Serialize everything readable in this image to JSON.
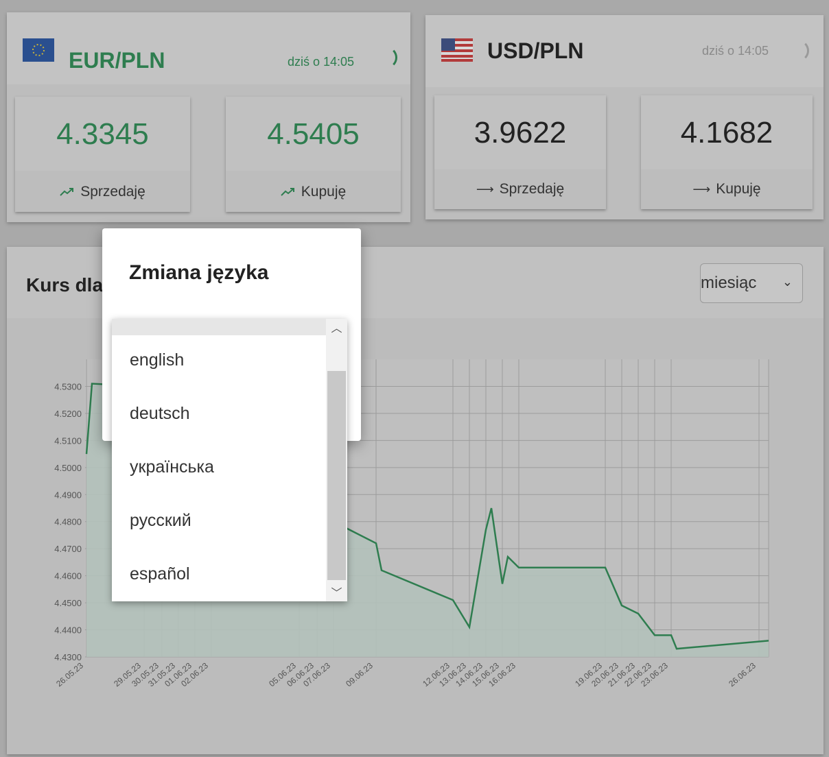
{
  "eur": {
    "pair": "EUR/PLN",
    "updated": "dziś o 14:05",
    "sell_value": "4.3345",
    "sell_label": "Sprzedaję",
    "buy_value": "4.5405",
    "buy_label": "Kupuję",
    "trend_icon": "trending-up-icon",
    "color": "#2e7d4f"
  },
  "usd": {
    "pair": "USD/PLN",
    "updated": "dziś o 14:05",
    "sell_value": "3.9622",
    "sell_label": "Sprzedaję",
    "buy_value": "4.1682",
    "buy_label": "Kupuję",
    "trend_icon": "arrow-right-icon"
  },
  "chart_section": {
    "title": "Kurs dla",
    "range_value": "miesiąc"
  },
  "modal": {
    "title": "Zmiana języka"
  },
  "language_dropdown": {
    "options": [
      "english",
      "deutsch",
      "українська",
      "русский",
      "español"
    ]
  },
  "chart_data": {
    "type": "line",
    "title": "",
    "xlabel": "",
    "ylabel": "",
    "ylim": [
      4.43,
      4.54
    ],
    "grid": true,
    "y_ticks": [
      "4.5300",
      "4.5200",
      "4.5100",
      "4.5000",
      "4.4900",
      "4.4800",
      "4.4700",
      "4.4600",
      "4.4500",
      "4.4400",
      "4.4300"
    ],
    "x_ticks": [
      "26.05.23",
      "29.05.23",
      "30.05.23",
      "31.05.23",
      "01.06.23",
      "02.06.23",
      "05.06.23",
      "06.06.23",
      "07.06.23",
      "09.06.23",
      "12.06.23",
      "13.06.23",
      "14.06.23",
      "15.06.23",
      "16.06.23",
      "19.06.23",
      "20.06.23",
      "21.06.23",
      "22.06.23",
      "23.06.23",
      "26.06.23"
    ],
    "series": [
      {
        "x": [
          "26.05.23",
          "26.05.23",
          "29.05.23",
          "07.06.23",
          "09.06.23",
          "09.06.23",
          "12.06.23",
          "13.06.23",
          "14.06.23",
          "14.06.23",
          "15.06.23",
          "15.06.23",
          "16.06.23",
          "19.06.23",
          "20.06.23",
          "21.06.23",
          "22.06.23",
          "23.06.23",
          "23.06.23",
          "26.06.23"
        ],
        "y": [
          4.505,
          4.531,
          4.53,
          4.48,
          4.472,
          4.462,
          4.451,
          4.441,
          4.477,
          4.485,
          4.457,
          4.467,
          4.463,
          4.463,
          4.449,
          4.446,
          4.438,
          4.438,
          4.433,
          4.436
        ]
      }
    ],
    "line_color": "#2e7d4f"
  }
}
